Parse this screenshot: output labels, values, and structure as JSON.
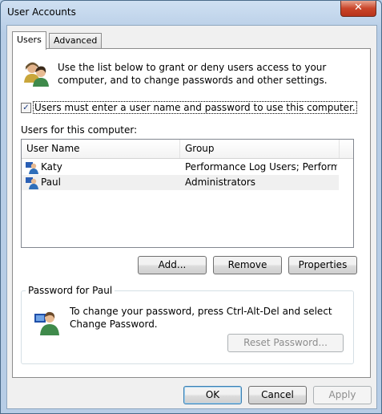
{
  "window": {
    "title": "User Accounts",
    "close_glyph": "✕"
  },
  "tabs": [
    {
      "label": "Users",
      "active": true
    },
    {
      "label": "Advanced",
      "active": false
    }
  ],
  "users_tab": {
    "icon": "users-icon",
    "description": "Use the list below to grant or deny users access to your computer, and to change passwords and other settings.",
    "checkbox": {
      "label": "Users must enter a user name and password to use this computer.",
      "checked": true,
      "glyph": "✓"
    },
    "list_caption": "Users for this computer:",
    "columns": [
      "User Name",
      "Group"
    ],
    "rows": [
      {
        "name": "Katy",
        "group": "Performance Log Users; Performa...",
        "icon": "user-icon"
      },
      {
        "name": "Paul",
        "group": "Administrators",
        "icon": "user-icon",
        "selected": true
      }
    ],
    "buttons": {
      "add": "Add...",
      "remove": "Remove",
      "properties": "Properties"
    },
    "password_group": {
      "title": "Password for Paul",
      "icon": "user-password-icon",
      "text": "To change your password, press Ctrl-Alt-Del and select Change Password.",
      "reset_button": "Reset Password..."
    }
  },
  "footer": {
    "ok": "OK",
    "cancel": "Cancel",
    "apply": "Apply"
  },
  "colors": {
    "title_bar": "#b9d1ea",
    "close_button": "#c9452a",
    "selection": "#f0f0f0"
  }
}
